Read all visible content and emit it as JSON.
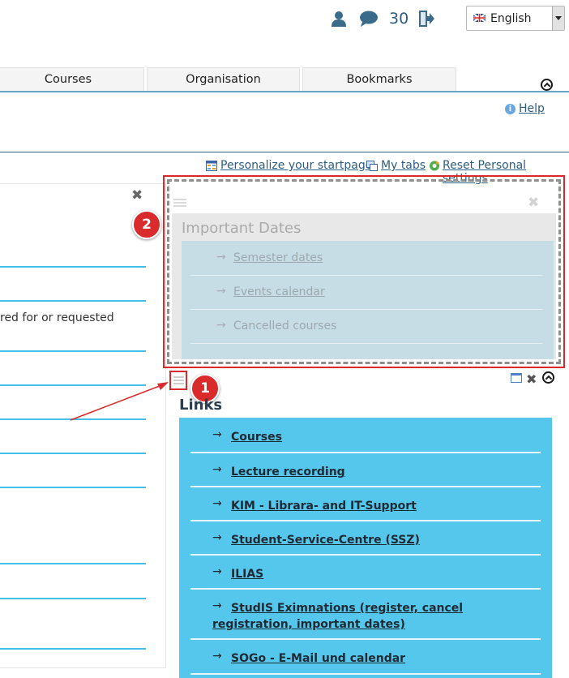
{
  "topbar": {
    "user_icon": "user-icon",
    "messages_icon": "speech-bubble-icon",
    "count": "30",
    "logout_icon": "logout-icon",
    "language": "English",
    "language_flag": "uk-flag-icon"
  },
  "nav": {
    "tabs": [
      "Courses",
      "Organisation",
      "Bookmarks"
    ],
    "accent_color": "#6ba6c4"
  },
  "help": {
    "label": "Help"
  },
  "personalize": {
    "start_page": "Personalize your startpage",
    "my_tabs": "My tabs",
    "reset": "Reset Personal settings"
  },
  "left_widget": {
    "visible_text": "red for or requested"
  },
  "dragged_widget": {
    "title": "Important Dates",
    "items": [
      "Semester dates",
      "Events calendar",
      "Cancelled courses"
    ]
  },
  "links_widget": {
    "title": "Links",
    "items": [
      "Courses",
      "Lecture recording",
      "KIM - Librara- and IT-Support",
      "Student-Service-Centre (SSZ)",
      "ILIAS",
      "StudIS Eximnations (register, cancel registration, important dates)",
      "SOGo - E-Mail und calendar"
    ],
    "panel_color": "#56c7ec"
  },
  "annotations": {
    "badge_1": "1",
    "badge_2": "2",
    "highlight_color": "#d92b2b"
  }
}
